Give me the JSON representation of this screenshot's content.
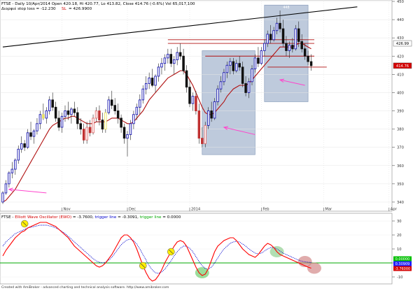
{
  "upper_header": {
    "title": "FTSE - Daily 10/Apr/2014 Open 420.18, Hi 420.77, Lo 413.82, Close 414.76 (-0.6%) Vol 65,017,100",
    "stop_text": "Διορφιέ stop loss = -12.230",
    "sl_label": "SL",
    "sl_value": "= 426.9900"
  },
  "lower_header": {
    "name": "FTSE - ",
    "ewo_label": "Elliott Wave Oscillator (EWO)",
    "ewo_value": " = -3.7600, ",
    "trig1_label": "trigger line",
    "trig1_value": " = -0.3091, ",
    "trig2_label": "trigger line",
    "trig2_value": " = 0.0000"
  },
  "footer": "Created with AmiBroker - advanced charting and technical analysis software. http://www.amibroker.com",
  "highlight_label": "448",
  "price_badges": [
    {
      "text": "426.99",
      "value": 426.99,
      "bg": "#ffffff",
      "fg": "#000000"
    },
    {
      "text": "414.76",
      "value": 414.76,
      "bg": "#d40000",
      "fg": "#ffffff"
    }
  ],
  "ewo_badges": [
    {
      "text": "0.00000",
      "bg": "#00c000",
      "fg": "#ffffff"
    },
    {
      "text": "0.30909",
      "bg": "#2020ff",
      "fg": "#ffffff"
    },
    {
      "text": "-3.76000",
      "bg": "#d40000",
      "fg": "#ffffff"
    }
  ],
  "colors": {
    "bull": "#1a1ab0",
    "bear": "#111111",
    "pink_bull": "#e07070",
    "pink_bear": "#c03030",
    "yellow_bull": "#e8e060",
    "ma": "#b01010",
    "highlight": "#a8b8d0",
    "ewo": "#ff0000",
    "ewo_trigger": "#0000cc",
    "zero_line": "#00aa00",
    "arrow": "#ff44cc"
  },
  "chart_data": [
    {
      "type": "candlestick",
      "title": "FTSE - Daily 10/Apr/2014",
      "ylim": [
        335,
        450
      ],
      "yticks": [
        340,
        350,
        360,
        370,
        380,
        390,
        400,
        410,
        420,
        430,
        440,
        450
      ],
      "xlabels": [
        {
          "label": "Nov",
          "bar": 19
        },
        {
          "label": "Dec",
          "bar": 40
        },
        {
          "label": "2014",
          "bar": 60
        },
        {
          "label": "Feb",
          "bar": 83
        },
        {
          "label": "Mar",
          "bar": 103
        },
        {
          "label": "Apr",
          "bar": 124
        }
      ],
      "last_close": 414.76,
      "stop_level": 426.99,
      "candles": [
        [
          340,
          346,
          339,
          345
        ],
        [
          345,
          352,
          344,
          350
        ],
        [
          350,
          357,
          348,
          356
        ],
        [
          356,
          362,
          353,
          358
        ],
        [
          358,
          364,
          355,
          363
        ],
        [
          363,
          371,
          361,
          369
        ],
        [
          369,
          376,
          367,
          372
        ],
        [
          372,
          374,
          368,
          370
        ],
        [
          370,
          380,
          369,
          378
        ],
        [
          378,
          384,
          374,
          376
        ],
        [
          376,
          380,
          372,
          379
        ],
        [
          379,
          386,
          377,
          383
        ],
        [
          383,
          390,
          380,
          388
        ],
        [
          388,
          394,
          385,
          386
        ],
        [
          386,
          392,
          383,
          390
        ],
        [
          390,
          398,
          388,
          396
        ],
        [
          396,
          400,
          390,
          392
        ],
        [
          392,
          395,
          384,
          386
        ],
        [
          386,
          390,
          379,
          381
        ],
        [
          381,
          389,
          378,
          387
        ],
        [
          387,
          393,
          384,
          390
        ],
        [
          390,
          395,
          385,
          388
        ],
        [
          388,
          392,
          383,
          391
        ],
        [
          391,
          395,
          387,
          389
        ],
        [
          389,
          392,
          380,
          383
        ],
        [
          383,
          386,
          377,
          380
        ],
        [
          380,
          383,
          372,
          374
        ],
        [
          374,
          384,
          372,
          381
        ],
        [
          381,
          385,
          376,
          378
        ],
        [
          378,
          388,
          377,
          386
        ],
        [
          386,
          392,
          384,
          390
        ],
        [
          390,
          393,
          382,
          385
        ],
        [
          385,
          389,
          378,
          380
        ],
        [
          380,
          391,
          378,
          389
        ],
        [
          389,
          398,
          388,
          396
        ],
        [
          396,
          401,
          391,
          393
        ],
        [
          393,
          397,
          388,
          390
        ],
        [
          390,
          394,
          383,
          386
        ],
        [
          386,
          388,
          378,
          381
        ],
        [
          381,
          383,
          372,
          375
        ],
        [
          375,
          379,
          365,
          377
        ],
        [
          377,
          385,
          374,
          383
        ],
        [
          383,
          390,
          380,
          388
        ],
        [
          388,
          394,
          385,
          392
        ],
        [
          392,
          399,
          388,
          396
        ],
        [
          396,
          404,
          394,
          402
        ],
        [
          402,
          409,
          399,
          405
        ],
        [
          405,
          411,
          402,
          408
        ],
        [
          408,
          413,
          403,
          404
        ],
        [
          404,
          410,
          400,
          409
        ],
        [
          409,
          416,
          406,
          414
        ],
        [
          414,
          419,
          410,
          416
        ],
        [
          416,
          421,
          412,
          419
        ],
        [
          419,
          424,
          416,
          421
        ],
        [
          421,
          424,
          414,
          416
        ],
        [
          416,
          420,
          410,
          418
        ],
        [
          418,
          425,
          415,
          422
        ],
        [
          422,
          427,
          418,
          420
        ],
        [
          420,
          424,
          410,
          412
        ],
        [
          412,
          415,
          400,
          403
        ],
        [
          403,
          407,
          392,
          394
        ],
        [
          394,
          400,
          390,
          398
        ],
        [
          398,
          401,
          388,
          390
        ],
        [
          390,
          394,
          372,
          375
        ],
        [
          375,
          381,
          370,
          372
        ],
        [
          372,
          384,
          370,
          382
        ],
        [
          382,
          392,
          380,
          390
        ],
        [
          390,
          395,
          384,
          386
        ],
        [
          386,
          397,
          385,
          395
        ],
        [
          395,
          404,
          393,
          402
        ],
        [
          402,
          409,
          400,
          406
        ],
        [
          406,
          413,
          404,
          411
        ],
        [
          411,
          417,
          408,
          415
        ],
        [
          415,
          419,
          410,
          417
        ],
        [
          417,
          419,
          410,
          412
        ],
        [
          412,
          418,
          411,
          416
        ],
        [
          416,
          420,
          412,
          414
        ],
        [
          414,
          417,
          403,
          405
        ],
        [
          405,
          409,
          398,
          400
        ],
        [
          400,
          408,
          397,
          406
        ],
        [
          406,
          415,
          404,
          413
        ],
        [
          413,
          421,
          411,
          419
        ],
        [
          419,
          425,
          414,
          416
        ],
        [
          416,
          425,
          415,
          423
        ],
        [
          423,
          429,
          420,
          427
        ],
        [
          427,
          434,
          425,
          432
        ],
        [
          432,
          437,
          427,
          429
        ],
        [
          429,
          436,
          428,
          434
        ],
        [
          434,
          441,
          432,
          438
        ],
        [
          438,
          445,
          433,
          435
        ],
        [
          435,
          440,
          425,
          427
        ],
        [
          427,
          431,
          420,
          423
        ],
        [
          423,
          428,
          419,
          426
        ],
        [
          426,
          430,
          422,
          424
        ],
        [
          424,
          437,
          423,
          435
        ],
        [
          435,
          439,
          425,
          428
        ],
        [
          428,
          432,
          422,
          424
        ],
        [
          424,
          427,
          418,
          420
        ],
        [
          420,
          423,
          415,
          417
        ],
        [
          417,
          421,
          412,
          414.76
        ]
      ],
      "moving_average": [
        340,
        341,
        343,
        345,
        347,
        350,
        353,
        356,
        359,
        362,
        365,
        368,
        371,
        374,
        377,
        380,
        382,
        383,
        384,
        385,
        386,
        386,
        387,
        387,
        386,
        385,
        384,
        383,
        383,
        383,
        384,
        384,
        384,
        384,
        385,
        386,
        386,
        386,
        385,
        384,
        383,
        383,
        384,
        386,
        388,
        390,
        393,
        396,
        398,
        400,
        402,
        404,
        406,
        408,
        409,
        410,
        411,
        412,
        412,
        410,
        407,
        404,
        400,
        396,
        392,
        389,
        388,
        388,
        389,
        391,
        393,
        395,
        398,
        400,
        402,
        403,
        404,
        404,
        404,
        405,
        407,
        409,
        411,
        413,
        415,
        417,
        419,
        421,
        423,
        425,
        425,
        425,
        425,
        425,
        426,
        427,
        427,
        426,
        425,
        424
      ],
      "horizontal_lines": [
        {
          "value": 429,
          "from_bar": 53,
          "to_bar": 100
        },
        {
          "value": 426.99,
          "from_bar": 53,
          "to_bar": 100
        },
        {
          "value": 420,
          "from_bar": 65,
          "to_bar": 100
        },
        {
          "value": 414,
          "from_bar": 85,
          "to_bar": 104
        }
      ],
      "trendline": {
        "from": {
          "bar": 0,
          "value": 425
        },
        "to": {
          "bar": 112,
          "value": 447
        }
      },
      "highlight_zones": [
        {
          "from_bar": 64,
          "to_bar": 81,
          "y_from": 366,
          "y_to": 423
        },
        {
          "from_bar": 84,
          "to_bar": 98,
          "y_from": 395,
          "y_to": 448
        }
      ],
      "arrows": [
        {
          "tip_bar": 2,
          "tip_value": 347,
          "tail_bar": 14,
          "tail_value": 345
        },
        {
          "tip_bar": 71,
          "tip_value": 381,
          "tail_bar": 81,
          "tail_value": 377
        },
        {
          "tip_bar": 89,
          "tip_value": 407,
          "tail_bar": 97,
          "tail_value": 404
        }
      ]
    },
    {
      "type": "line",
      "title": "Elliott Wave Oscillator (EWO)",
      "ylim": [
        -15,
        35
      ],
      "yticks": [
        -10,
        0,
        10,
        20,
        30
      ],
      "series": [
        {
          "name": "Elliott Wave Oscillator (EWO)",
          "values": [
            5,
            9,
            12,
            15,
            18,
            20,
            22,
            23,
            25,
            26,
            27,
            28,
            29,
            29,
            29,
            28,
            27,
            26,
            24,
            22,
            20,
            18,
            15,
            12,
            10,
            8,
            6,
            4,
            2,
            0,
            -2,
            -3,
            -2,
            0,
            3,
            6,
            10,
            14,
            18,
            20,
            20,
            18,
            15,
            10,
            4,
            -2,
            -7,
            -11,
            -13,
            -12,
            -9,
            -5,
            0,
            4,
            8,
            12,
            15,
            16,
            15,
            12,
            7,
            2,
            -3,
            -7,
            -9,
            -8,
            -4,
            2,
            8,
            12,
            14,
            16,
            17,
            18,
            18,
            16,
            13,
            10,
            8,
            6,
            5,
            4,
            6,
            9,
            12,
            14,
            13,
            11,
            8,
            6,
            5,
            4,
            3,
            2,
            1,
            0,
            -1,
            -2,
            -3,
            -3.76
          ]
        },
        {
          "name": "trigger line",
          "values": [
            12,
            15,
            17,
            19,
            21,
            22,
            23,
            24,
            25,
            25.5,
            26,
            26.5,
            27,
            27,
            27,
            26.5,
            26,
            25,
            24,
            22.5,
            21,
            19,
            17,
            15,
            13,
            11,
            9,
            7,
            5,
            3,
            1.5,
            0.5,
            0,
            0.5,
            2,
            4,
            7,
            10,
            13,
            15,
            16.5,
            17,
            16,
            13.5,
            10,
            6,
            2,
            -2,
            -5,
            -7,
            -7.5,
            -6.5,
            -4.5,
            -1.5,
            1.5,
            5,
            8,
            10.5,
            12,
            12,
            10.5,
            8,
            4.5,
            1,
            -2,
            -4,
            -4.5,
            -3,
            0,
            3.5,
            7,
            10,
            12,
            14,
            15,
            15.5,
            15,
            13.5,
            12,
            10,
            8.5,
            7,
            6.5,
            7,
            8.5,
            10,
            11,
            11,
            10,
            8.5,
            7,
            6,
            5,
            4,
            3,
            2,
            1.2,
            0.8,
            0.5,
            0.31
          ]
        },
        {
          "name": "trigger line",
          "values": [
            0
          ]
        }
      ],
      "markers": [
        {
          "bar": 7,
          "value": 28,
          "color": "#ffee00",
          "kind": "dot"
        },
        {
          "bar": 45,
          "value": -2,
          "color": "#ffee00",
          "kind": "dot"
        },
        {
          "bar": 54,
          "value": 8,
          "color": "#ffee00",
          "kind": "dot"
        },
        {
          "bar": 64,
          "value": -7,
          "color": "#66cc66",
          "kind": "glow"
        },
        {
          "bar": 88,
          "value": 8,
          "color": "#88cc88",
          "kind": "glow"
        },
        {
          "bar": 97,
          "value": 1,
          "color": "#d08080",
          "kind": "glow"
        },
        {
          "bar": 100,
          "value": -3.76,
          "color": "#d08080",
          "kind": "glow"
        }
      ]
    }
  ]
}
